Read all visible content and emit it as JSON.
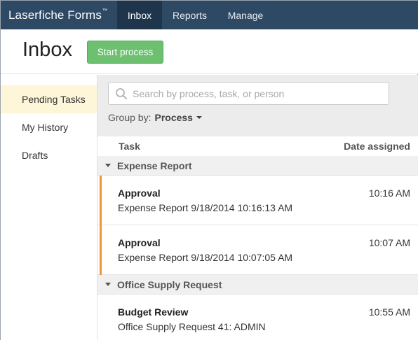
{
  "nav": {
    "brand": "Laserfiche Forms",
    "brand_tm": "™",
    "tabs": [
      {
        "label": "Inbox",
        "active": true
      },
      {
        "label": "Reports",
        "active": false
      },
      {
        "label": "Manage",
        "active": false
      }
    ]
  },
  "header": {
    "title": "Inbox",
    "start_button": "Start process"
  },
  "sidebar": {
    "items": [
      {
        "label": "Pending Tasks",
        "active": true
      },
      {
        "label": "My History",
        "active": false
      },
      {
        "label": "Drafts",
        "active": false
      }
    ]
  },
  "filters": {
    "search_placeholder": "Search by process, task, or person",
    "search_value": "",
    "group_by_label": "Group by:",
    "group_by_value": "Process"
  },
  "table": {
    "col_task": "Task",
    "col_date": "Date assigned",
    "groups": [
      {
        "name": "Expense Report",
        "tasks": [
          {
            "name": "Approval",
            "desc": "Expense Report 9/18/2014 10:16:13 AM",
            "time": "10:16 AM",
            "flagged": true
          },
          {
            "name": "Approval",
            "desc": "Expense Report 9/18/2014 10:07:05 AM",
            "time": "10:07 AM",
            "flagged": true
          }
        ]
      },
      {
        "name": "Office Supply Request",
        "tasks": [
          {
            "name": "Budget Review",
            "desc": "Office Supply Request 41: ADMIN",
            "time": "10:55 AM",
            "flagged": false
          }
        ]
      }
    ]
  },
  "colors": {
    "navbar": "#2d4964",
    "navbar_active": "#1f354b",
    "start_button": "#6cc070",
    "sidebar_active": "#fdf6d9",
    "flag": "#f0963c"
  }
}
